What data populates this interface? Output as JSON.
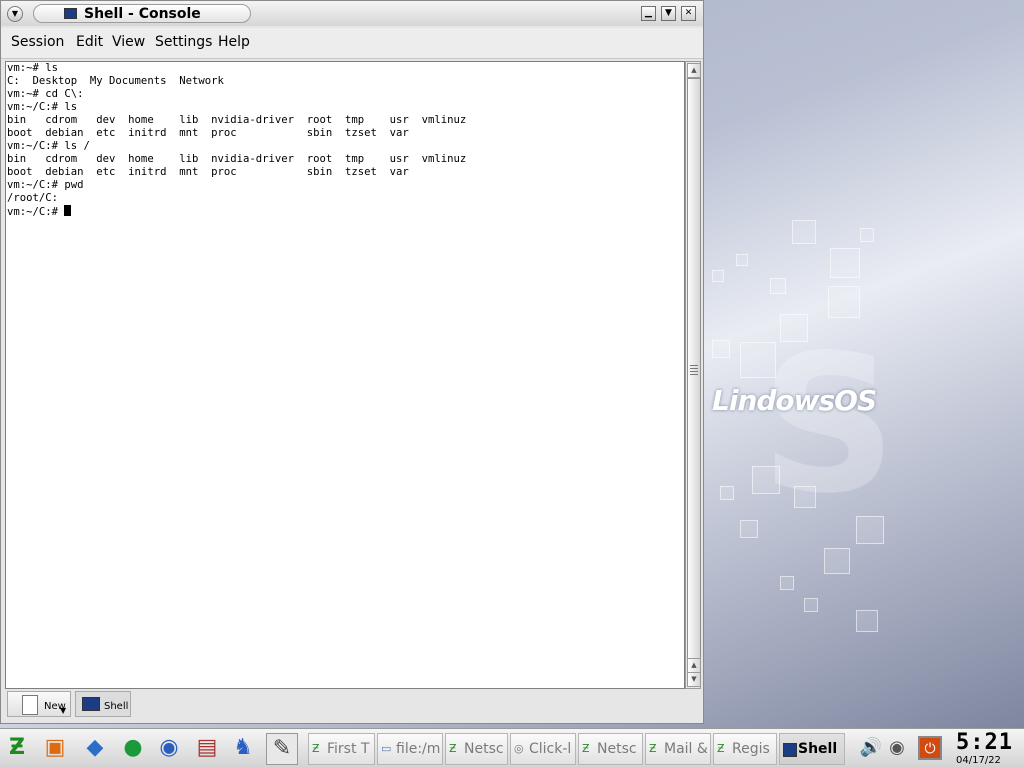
{
  "window": {
    "title": "Shell - Console",
    "menu": [
      "Session",
      "Edit",
      "View",
      "Settings",
      "Help"
    ]
  },
  "terminal": {
    "lines": [
      "vm:~# ls",
      "C:  Desktop  My Documents  Network",
      "vm:~# cd C\\:",
      "vm:~/C:# ls",
      "bin   cdrom   dev  home    lib  nvidia-driver  root  tmp    usr  vmlinuz",
      "boot  debian  etc  initrd  mnt  proc           sbin  tzset  var",
      "vm:~/C:# ls /",
      "bin   cdrom   dev  home    lib  nvidia-driver  root  tmp    usr  vmlinuz",
      "boot  debian  etc  initrd  mnt  proc           sbin  tzset  var",
      "vm:~/C:# pwd",
      "/root/C:",
      "vm:~/C:# "
    ]
  },
  "tabs": {
    "new_label": "New",
    "shell_label": "Shell"
  },
  "desktop": {
    "brand": "LindowsOS"
  },
  "taskbar": {
    "tasks": [
      "First T",
      "file:/m",
      "Netsc",
      "Click-l",
      "Netsc",
      "Mail &",
      "Regis",
      "Shell"
    ],
    "clock_time": "5:21",
    "clock_date": "04/17/22"
  }
}
